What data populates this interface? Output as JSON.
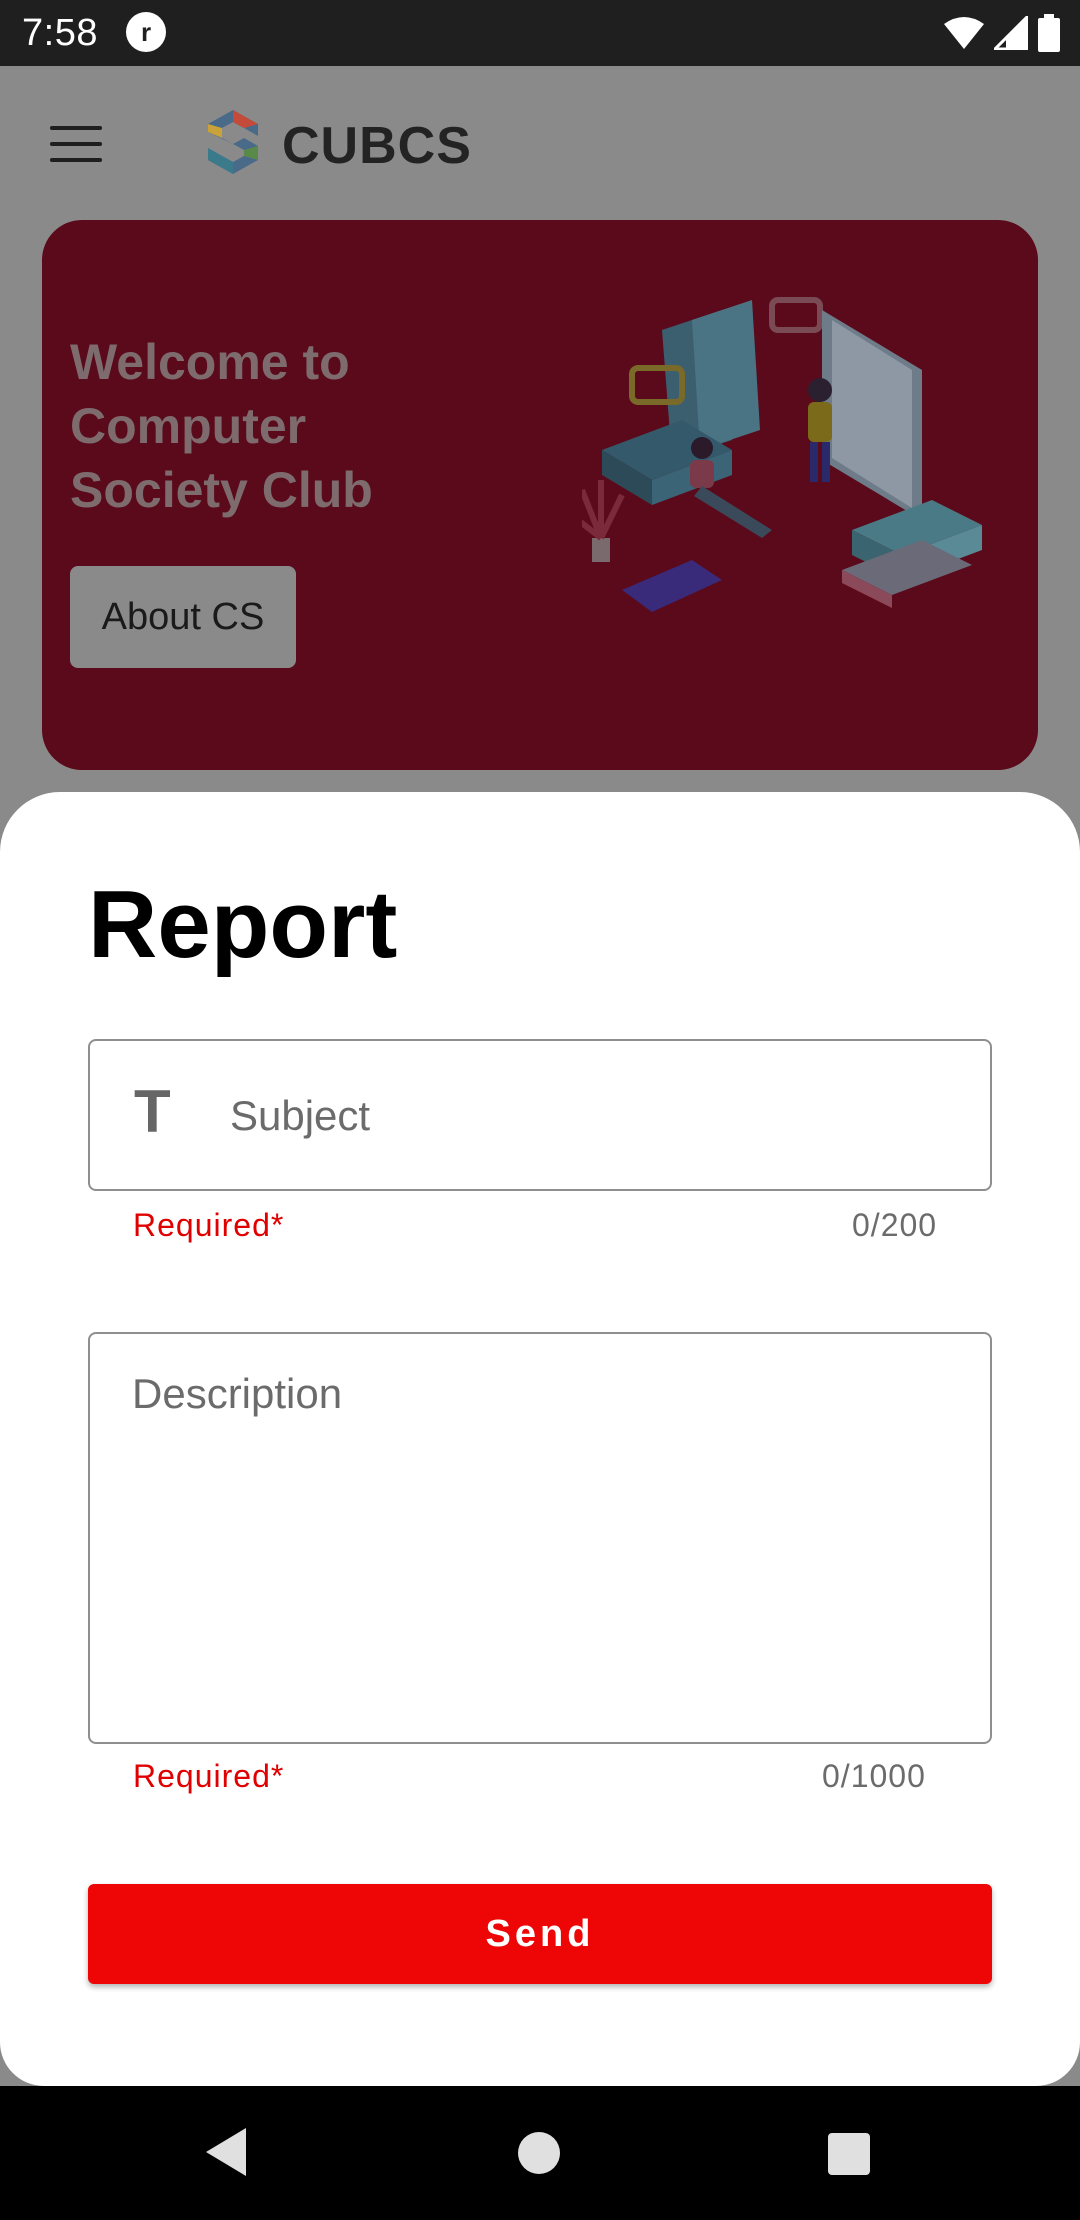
{
  "status_bar": {
    "time": "7:58",
    "app_icon": "notification-app-icon",
    "icons": [
      "wifi-icon",
      "cell-signal-icon",
      "battery-icon"
    ]
  },
  "app": {
    "title": "CUBCS",
    "menu_icon": "hamburger-menu-icon",
    "logo_icon": "cubcs-logo-icon",
    "hero": {
      "heading": "Welcome to Computer Society Club",
      "button_label": "About CS",
      "background_color": "#5a0a1a"
    }
  },
  "report_sheet": {
    "title": "Report",
    "subject": {
      "icon": "text-format-icon",
      "icon_glyph": "T",
      "placeholder": "Subject",
      "value": "",
      "helper": "Required*",
      "counter": "0/200"
    },
    "description": {
      "placeholder": "Description",
      "value": "",
      "helper": "Required*",
      "counter": "0/1000"
    },
    "send_label": "Send",
    "accent_color": "#ee0606",
    "error_color": "#e00000"
  },
  "nav_bar": {
    "icons": [
      "back-icon",
      "home-icon",
      "recent-apps-icon"
    ]
  }
}
